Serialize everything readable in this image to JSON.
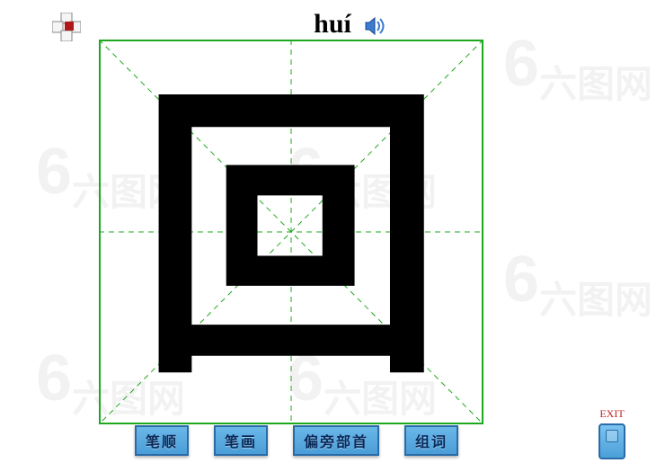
{
  "pinyin": "huí",
  "character": "回",
  "buttons": {
    "stroke_order": "笔顺",
    "strokes": "笔画",
    "radical": "偏旁部首",
    "words": "组词"
  },
  "exit": {
    "label": "EXIT"
  },
  "icons": {
    "speaker": "audio-play",
    "decoration": "puzzle-cross"
  },
  "watermark": {
    "text": "六图网",
    "logo": "6"
  }
}
